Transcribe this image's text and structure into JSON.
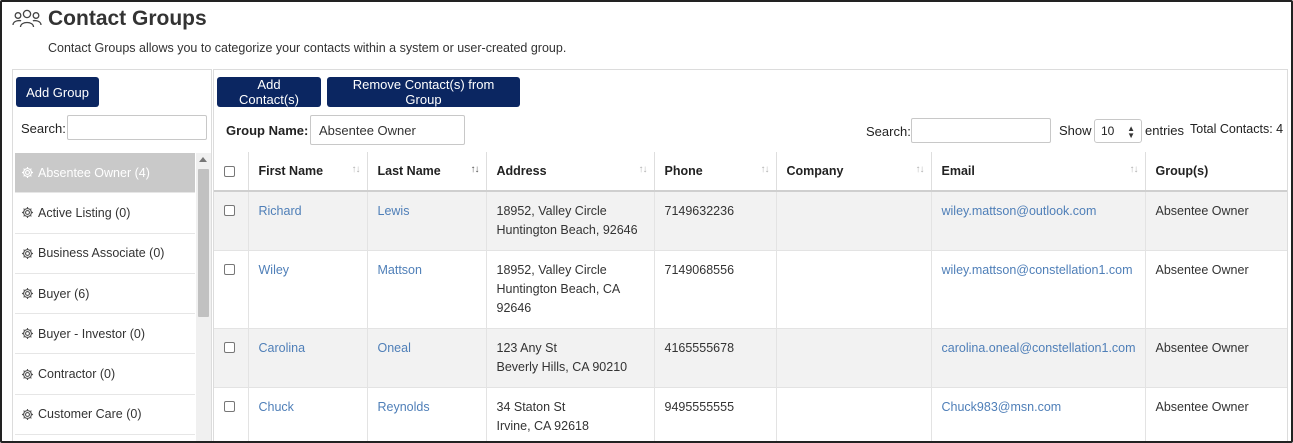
{
  "page": {
    "title": "Contact Groups",
    "subtitle": "Contact Groups allows you to categorize your contacts within a system or user-created group."
  },
  "left": {
    "add_group_label": "Add Group",
    "search_label": "Search:",
    "search_value": "",
    "groups": [
      {
        "label": "Absentee Owner (4)",
        "active": true
      },
      {
        "label": "Active Listing (0)",
        "active": false
      },
      {
        "label": "Business Associate (0)",
        "active": false
      },
      {
        "label": "Buyer (6)",
        "active": false
      },
      {
        "label": "Buyer - Investor (0)",
        "active": false
      },
      {
        "label": "Contractor (0)",
        "active": false
      },
      {
        "label": "Customer Care (0)",
        "active": false
      }
    ]
  },
  "toolbar": {
    "add_contacts_label": "Add Contact(s)",
    "remove_contacts_label": "Remove Contact(s) from Group",
    "group_name_label": "Group Name:",
    "group_name_value": "Absentee Owner",
    "search_label": "Search:",
    "search_value": "",
    "show_label": "Show",
    "show_value": "10",
    "entries_label": "entries",
    "total_label": "Total Contacts: 4"
  },
  "table": {
    "headers": [
      "",
      "First Name",
      "Last Name",
      "Address",
      "Phone",
      "Company",
      "Email",
      "Group(s)"
    ],
    "rows": [
      {
        "first": "Richard",
        "last": "Lewis",
        "address1": "18952, Valley Circle",
        "address2": "Huntington Beach, 92646",
        "address3": "",
        "phone": "7149632236",
        "company": "",
        "email": "wiley.mattson@outlook.com",
        "groups": "Absentee Owner"
      },
      {
        "first": "Wiley",
        "last": "Mattson",
        "address1": "18952, Valley Circle",
        "address2": "Huntington Beach, CA",
        "address3": "92646",
        "phone": "7149068556",
        "company": "",
        "email": "wiley.mattson@constellation1.com",
        "groups": "Absentee Owner"
      },
      {
        "first": "Carolina",
        "last": "Oneal",
        "address1": "123 Any St",
        "address2": "Beverly Hills, CA 90210",
        "address3": "",
        "phone": "4165555678",
        "company": "",
        "email": "carolina.oneal@constellation1.com",
        "groups": "Absentee Owner"
      },
      {
        "first": "Chuck",
        "last": "Reynolds",
        "address1": "34 Staton St",
        "address2": "Irvine, CA 92618",
        "address3": "",
        "phone": "9495555555",
        "company": "",
        "email": "Chuck983@msn.com",
        "groups": "Absentee Owner"
      }
    ]
  },
  "icons": {
    "title_icon": "users-group-icon",
    "group_icon": "gear-icon",
    "sort_icon": "sort-arrows-icon"
  },
  "colors": {
    "primary_button": "#0b2661",
    "link": "#4f7fb8",
    "active_group_bg": "#c9c9c9",
    "stripe": "#f2f2f2"
  }
}
